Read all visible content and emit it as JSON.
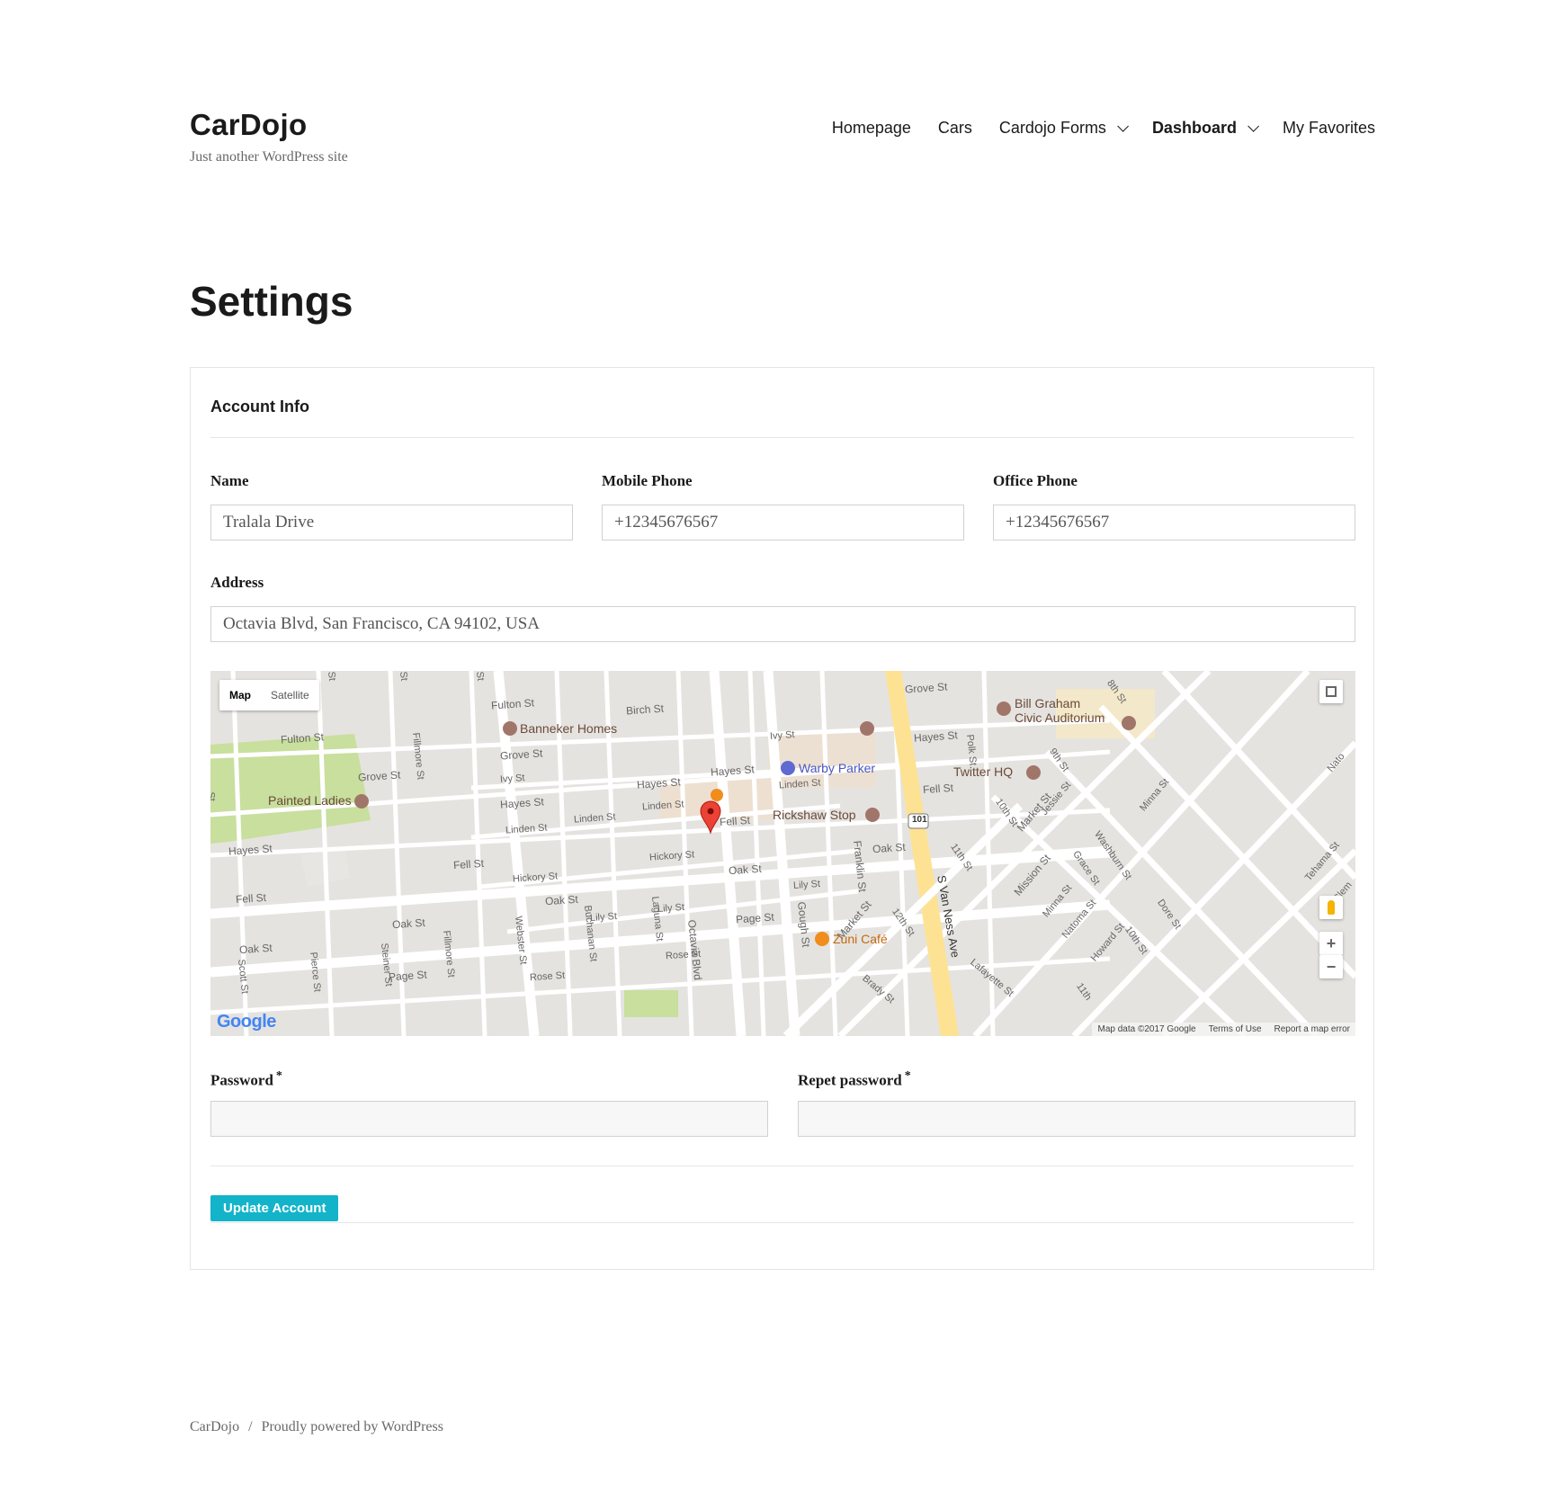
{
  "site": {
    "title": "CarDojo",
    "tagline": "Just another WordPress site"
  },
  "nav": {
    "items": [
      {
        "label": "Homepage"
      },
      {
        "label": "Cars"
      },
      {
        "label": "Cardojo Forms"
      },
      {
        "label": "Dashboard"
      },
      {
        "label": "My Favorites"
      }
    ]
  },
  "page": {
    "title": "Settings"
  },
  "form": {
    "section_title": "Account Info",
    "name_label": "Name",
    "name_value": "Tralala Drive",
    "mobile_label": "Mobile Phone",
    "mobile_value": "+12345676567",
    "office_label": "Office Phone",
    "office_value": "+12345676567",
    "address_label": "Address",
    "address_value": "Octavia Blvd, San Francisco, CA 94102, USA",
    "password_label": "Password",
    "repeat_password_label": "Repet password",
    "required_mark": "*",
    "submit_label": "Update Account"
  },
  "map": {
    "type_map": "Map",
    "type_satellite": "Satellite",
    "zoom_in": "+",
    "zoom_out": "−",
    "logo": "Google",
    "credit_data": "Map data ©2017 Google",
    "credit_terms": "Terms of Use",
    "credit_report": "Report a map error",
    "places": {
      "banneker": "Banneker Homes",
      "painted_ladies": "Painted Ladies",
      "warby": "Warby Parker",
      "rickshaw": "Rickshaw Stop",
      "twitter": "Twitter HQ",
      "bill_graham_1": "Bill Graham",
      "bill_graham_2": "Civic Auditorium",
      "zuni": "Zuni Café",
      "highway": "101"
    },
    "streets": {
      "fulton": "Fulton St",
      "fulton2": "Fulton St",
      "birch": "Birch St",
      "grove": "Grove St",
      "grove2": "Grove St",
      "grove3": "Grove St",
      "ivy": "Ivy St",
      "ivy2": "Ivy St",
      "hayes": "Hayes St",
      "hayes2": "Hayes St",
      "hayes3": "Hayes St",
      "hayes4": "Hayes St",
      "hayes5": "Hayes St",
      "linden": "Linden St",
      "linden2": "Linden St",
      "linden3": "Linden St",
      "linden4": "Linden St",
      "fell": "Fell St",
      "fell2": "Fell St",
      "fell3": "Fell St",
      "fell4": "Fell St",
      "hickory": "Hickory St",
      "hickory2": "Hickory St",
      "oak": "Oak St",
      "oak2": "Oak St",
      "oak3": "Oak St",
      "oak4": "Oak St",
      "oak5": "Oak St",
      "lily": "Lily St",
      "lily2": "Lily St",
      "lily3": "Lily St",
      "page": "Page St",
      "page2": "Page St",
      "rose": "Rose St",
      "rose2": "Rose St",
      "octavia": "Octavia Blvd",
      "gough": "Gough St",
      "franklin": "Franklin St",
      "van_ness": "S Van Ness Ave",
      "fillmore": "Fillmore St",
      "fillmore2": "Fillmore St",
      "webster": "Webster St",
      "buchanan": "Buchanan St",
      "laguna": "Laguna St",
      "steiner": "Steiner St",
      "pierce": "Pierce St",
      "scott": "Scott St",
      "market": "Market St",
      "market2": "Market St",
      "polk": "Polk St",
      "tenth": "10th St",
      "tenth2": "10th St",
      "eleventh": "11th St",
      "eleventh2": "11th",
      "twelfth": "12th St",
      "ninth": "9th St",
      "eighth": "8th St",
      "jessie": "Jessie St",
      "minna": "Minna St",
      "minna2": "Minna St",
      "natoma": "Natoma St",
      "natoma2": "Nato",
      "mission": "Mission St",
      "grace": "Grace St",
      "washburn": "Washburn St",
      "howard": "Howard St",
      "dore": "Dore St",
      "tehama": "Tehama St",
      "clem": "Clem",
      "lafayette": "Lafayette St",
      "brady": "Brady St",
      "st1": "St",
      "st2": "St",
      "st3": "St",
      "st4": "St"
    }
  },
  "footer": {
    "site": "CarDojo",
    "separator": "/",
    "powered": "Proudly powered by WordPress"
  },
  "colors": {
    "accent": "#13b4c9",
    "park": "#c8df9e",
    "highway": "#fde293",
    "pin": "#ea4335"
  }
}
